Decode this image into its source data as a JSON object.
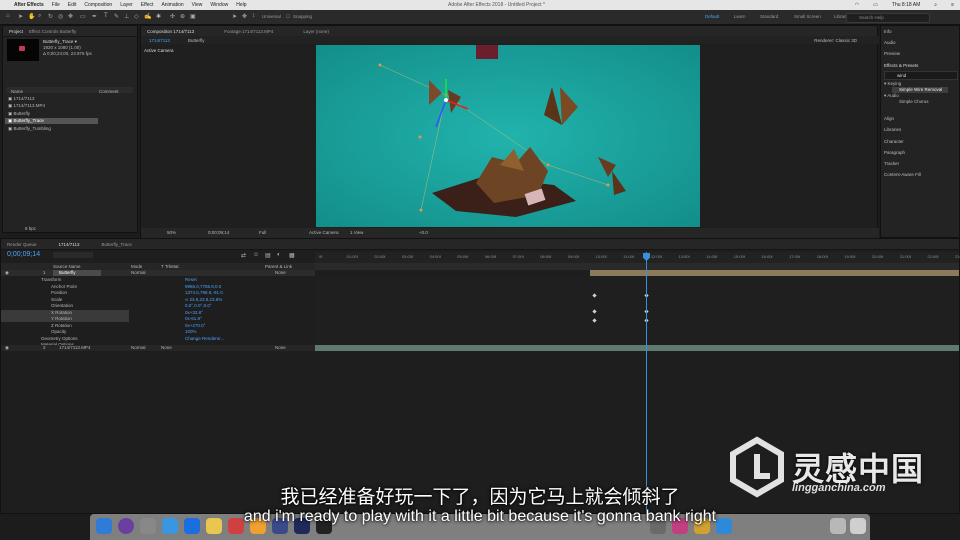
{
  "menubar": {
    "app": "After Effects",
    "menus": [
      "File",
      "Edit",
      "Composition",
      "Layer",
      "Effect",
      "Animation",
      "View",
      "Window",
      "Help"
    ],
    "window_title": "Adobe After Effects 2018 - Untitled Project *",
    "clock": "Thu 8:18 AM"
  },
  "toolbar": {
    "snapping_label": "Snapping",
    "universal_label": "Universal",
    "workspaces": [
      "Default",
      "Learn",
      "Standard",
      "Small Screen",
      "Libraries"
    ],
    "active_workspace": "Default",
    "search_placeholder": "Search Help"
  },
  "project": {
    "tabs": [
      "Project",
      "Effect Controls Butterfly"
    ],
    "selected_name": "Butterfly_Trace ▾",
    "selected_info1": "1920 x 1080 (1.00)",
    "selected_info2": "Δ 0;00;24;00, 23.976 fps",
    "column_name": "Name",
    "column_comment": "Comment",
    "items": [
      "1714/7113",
      "1714/7113.MP4",
      "Butterfly",
      "Butterfly_Trace",
      "Butterfly_Tumbling"
    ],
    "selected_index": 3,
    "bpc": "8 bpc"
  },
  "composition": {
    "tabs": [
      "Composition 1714/7113",
      "Footage 1714/7113.MP4",
      "Layer (none)"
    ],
    "subtabs": [
      "1714/7113",
      "Butterfly"
    ],
    "camera_label": "Active Camera",
    "renderer_label": "Renderer:",
    "renderer_value": "Classic 3D",
    "controls": [
      "50%",
      "0;00;09;14",
      "Full",
      "Active Camera",
      "1 View",
      "+0.0"
    ]
  },
  "right_panel": {
    "sections": [
      "Info",
      "Audio",
      "Preview",
      "Effects & Presets",
      "Align",
      "Libraries",
      "Character",
      "Paragraph",
      "Tracker",
      "Content-Aware Fill"
    ],
    "search_value": "wind",
    "tree": [
      "▾ Keying",
      "Simple Wire Removal",
      "▾ Audio",
      "Simple Chorus"
    ]
  },
  "timeline": {
    "tabs": [
      "Render Queue",
      "1714/7113",
      "Butterfly_Trace"
    ],
    "timecode": "0;00;09;14",
    "headers": [
      "Source Name",
      "Mode",
      "T TrkMat",
      "Parent & Link"
    ],
    "layers": [
      {
        "num": "1",
        "name": "Butterfly",
        "mode": "Normal",
        "parent": "None"
      },
      {
        "num": "2",
        "name": "1714/7113.MP4",
        "mode": "Normal",
        "trkmat": "None",
        "parent": "None"
      }
    ],
    "properties": [
      {
        "name": "Transform",
        "value": "Reset"
      },
      {
        "name": "Anchor Point",
        "value": "9966.0,7755.9,0.0"
      },
      {
        "name": "Position",
        "value": "1374.6,798.8,-91.0"
      },
      {
        "name": "Scale",
        "value": "∞ 23.8,23.8,23.8%"
      },
      {
        "name": "Orientation",
        "value": "0.0°,0.0°,0.0°"
      },
      {
        "name": "X Rotation",
        "value": "0x+32.8°"
      },
      {
        "name": "Y Rotation",
        "value": "0x-61.8°"
      },
      {
        "name": "Z Rotation",
        "value": "0x+270.0°"
      },
      {
        "name": "Opacity",
        "value": "100%"
      },
      {
        "name": "Geometry Options",
        "value": "Change Renderer..."
      },
      {
        "name": "Material Options",
        "value": ""
      }
    ],
    "ruler": [
      "0f",
      "01:00f",
      "02:00f",
      "03:00f",
      "04:00f",
      "05:00f",
      "06:00f",
      "07:00f",
      "08:00f",
      "09:00f",
      "10:00f",
      "11:00f",
      "12:00f",
      "13:00f",
      "14:00f",
      "15:00f",
      "16:00f",
      "17:00f",
      "18:00f",
      "19:00f",
      "20:00f",
      "21:00f",
      "22:00f",
      "23:00f"
    ]
  },
  "subtitles": {
    "cn": "我已经准备好玩一下了，因为它马上就会倾斜了",
    "en": "and i'm ready to play with it a little bit because it's gonna bank right"
  },
  "watermark": {
    "cn": "灵感中国",
    "en": "lingganchina.com"
  },
  "colors": {
    "greenscreen": "#1aa49f",
    "accent": "#4aa3ff",
    "layer_bar": "#8c7a5e",
    "video_bar": "#5f7a72"
  }
}
